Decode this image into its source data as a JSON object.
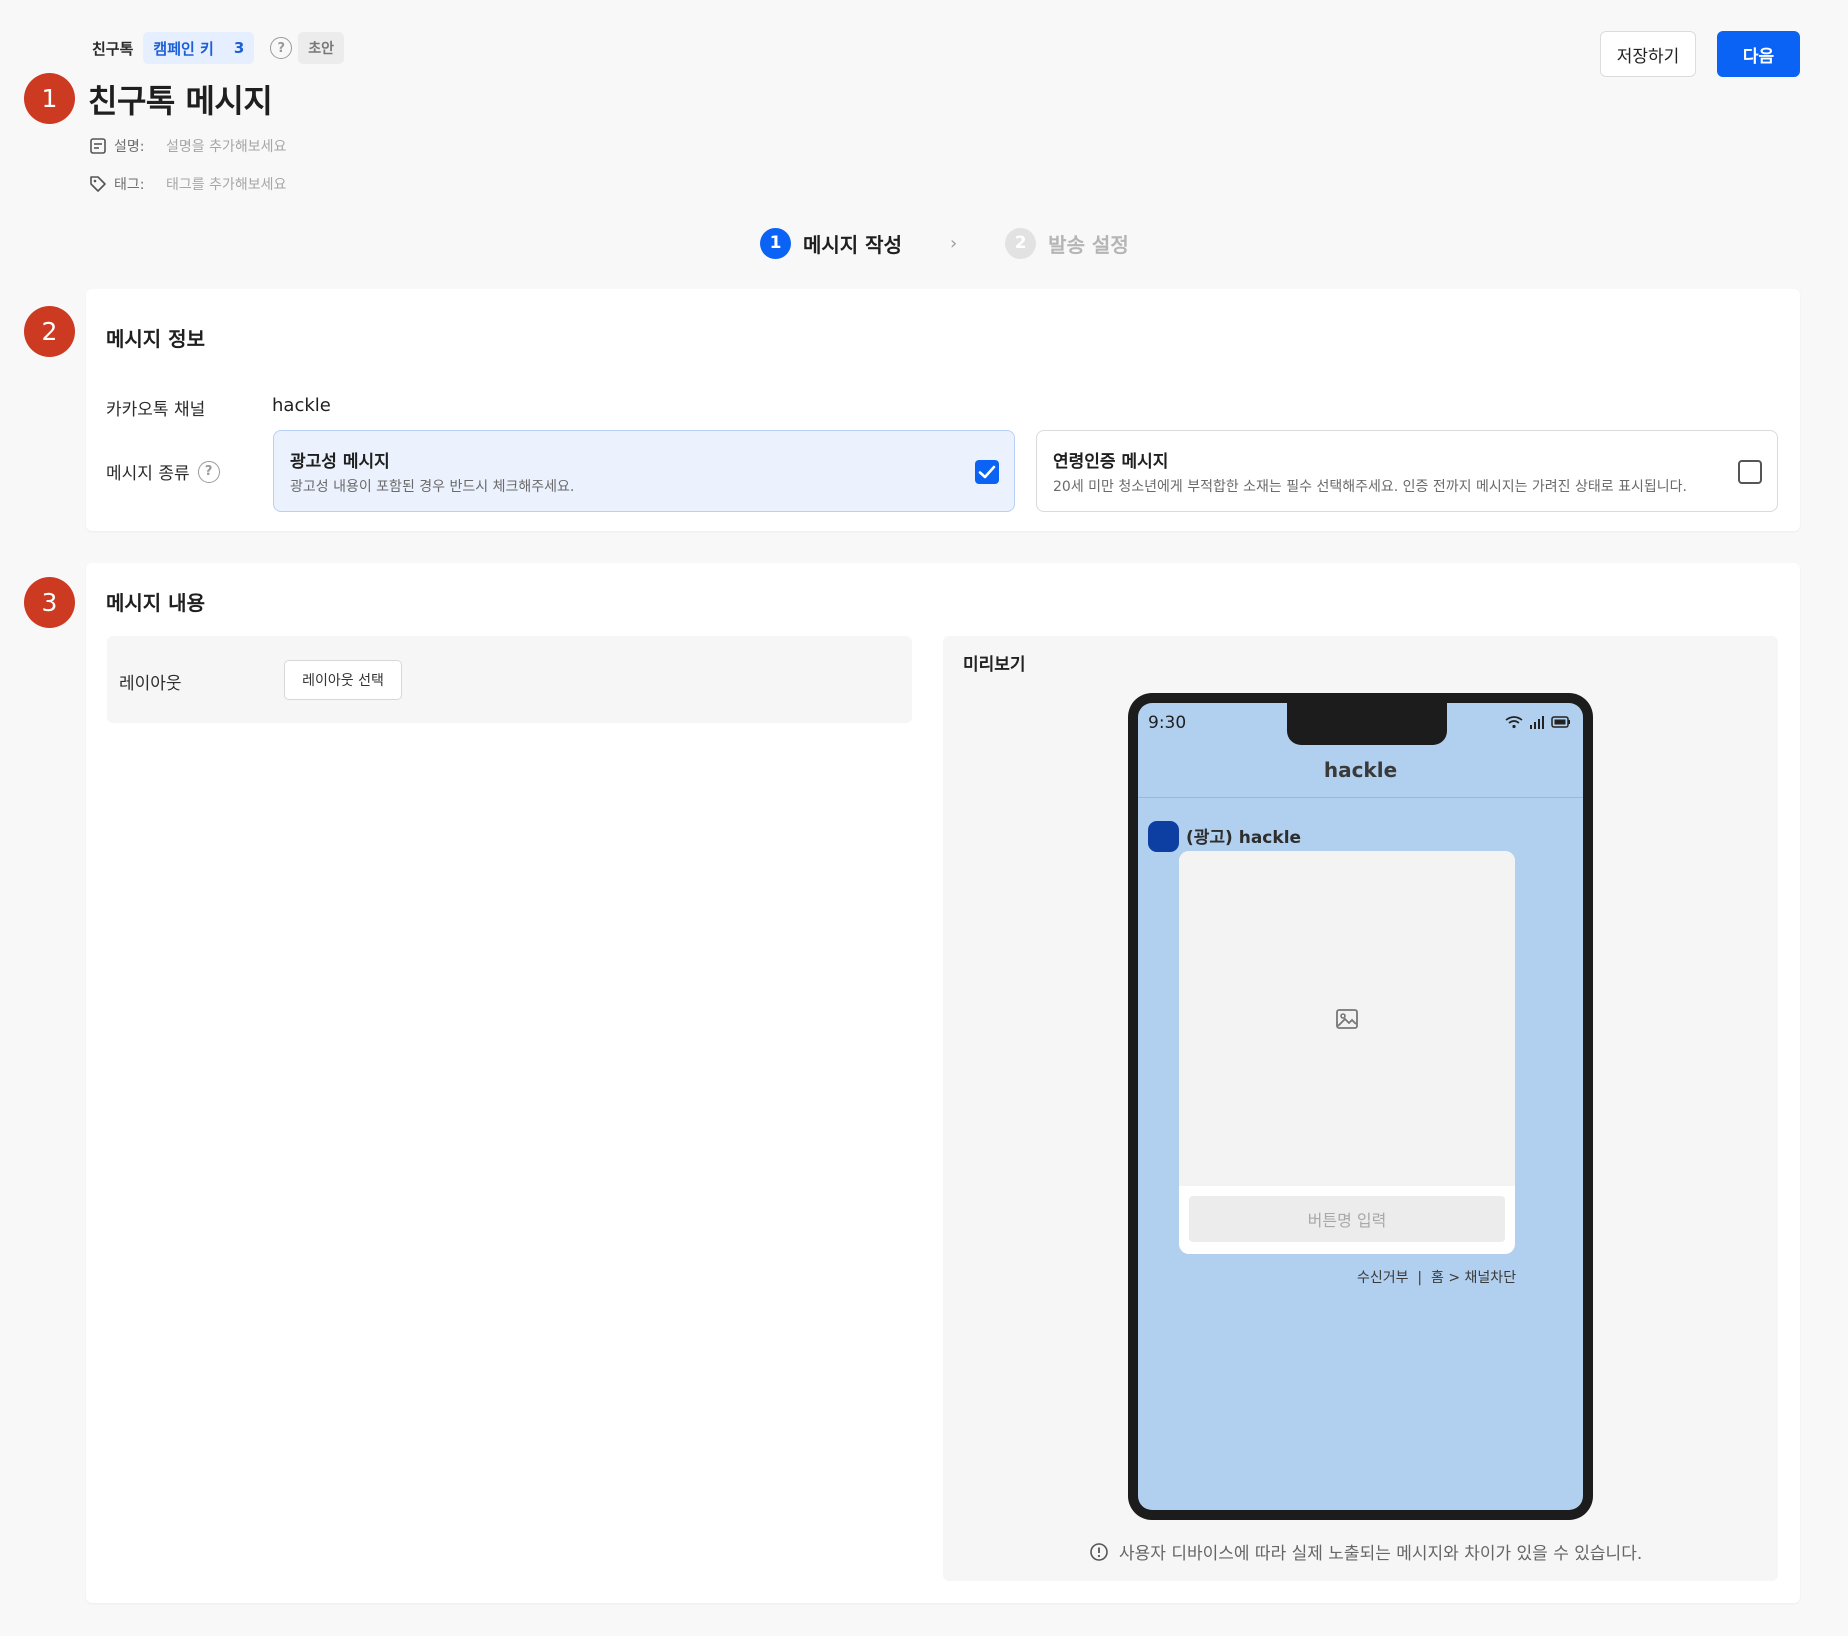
{
  "header": {
    "channel_type": "친구톡",
    "campaign_key_label": "캠페인 키",
    "campaign_key_count": "3",
    "help_glyph": "?",
    "status": "초안",
    "title": "친구톡 메시지",
    "description_label": "설명:",
    "description_placeholder": "설명을 추가해보세요",
    "tag_label": "태그:",
    "tag_placeholder": "태그를 추가해보세요",
    "save_label": "저장하기",
    "next_label": "다음"
  },
  "stepper": {
    "steps": [
      {
        "number": "1",
        "label": "메시지 작성"
      },
      {
        "number": "2",
        "label": "발송 설정"
      }
    ],
    "separator": "›"
  },
  "annotations": {
    "marker1": "1",
    "marker2": "2",
    "marker3": "3"
  },
  "message_info": {
    "title": "메시지 정보",
    "channel_label": "카카오톡 채널",
    "channel_value": "hackle",
    "type_label": "메시지 종류",
    "options": [
      {
        "title": "광고성 메시지",
        "description": "광고성 내용이 포함된 경우 반드시 체크해주세요.",
        "checked": true
      },
      {
        "title": "연령인증 메시지",
        "description": "20세 미만 청소년에게 부적합한 소재는 필수 선택해주세요. 인증 전까지 메시지는 가려진 상태로 표시됩니다.",
        "checked": false
      }
    ]
  },
  "message_content": {
    "title": "메시지 내용",
    "layout_label": "레이아웃",
    "layout_button": "레이아웃 선택",
    "preview": {
      "title": "미리보기",
      "time": "9:30",
      "chat_title": "hackle",
      "sender": "(광고) hackle",
      "button_placeholder": "버튼명 입력",
      "optout": "수신거부  |  홈 > 채널차단",
      "notice": "사용자 디바이스에 따라 실제 노출되는 메시지와 차이가 있을 수 있습니다."
    }
  },
  "colors": {
    "primary": "#0b63f6",
    "marker": "#cc3a22",
    "chat_background": "#b1cfee",
    "avatar": "#0d3fa3"
  },
  "icons": [
    "memo-icon",
    "tag-icon",
    "help-icon",
    "check-icon",
    "image-icon",
    "wifi-icon",
    "signal-icon",
    "battery-icon",
    "info-icon"
  ]
}
